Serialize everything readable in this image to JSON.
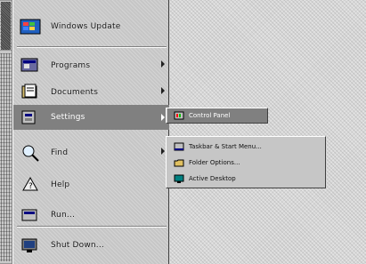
{
  "menu": {
    "header_label": "Windows Update",
    "items": [
      {
        "label": "Programs",
        "icon": "programs-icon",
        "has_submenu": true
      },
      {
        "label": "Documents",
        "icon": "documents-icon",
        "has_submenu": true
      },
      {
        "label": "Settings",
        "icon": "settings-icon",
        "has_submenu": true,
        "active": true
      },
      {
        "label": "Find",
        "icon": "find-icon",
        "has_submenu": true
      },
      {
        "label": "Help",
        "icon": "help-icon",
        "has_submenu": false
      },
      {
        "label": "Run...",
        "icon": "run-icon",
        "has_submenu": false
      },
      {
        "label": "Shut Down...",
        "icon": "shutdown-icon",
        "has_submenu": false
      }
    ]
  },
  "submenu_settings": {
    "items": [
      {
        "label": "Control Panel",
        "icon": "control-panel-icon",
        "active": true
      }
    ]
  },
  "submenu_settings_extra": {
    "items": [
      {
        "label": "Taskbar & Start Menu...",
        "icon": "taskbar-icon"
      },
      {
        "label": "Folder Options...",
        "icon": "folder-options-icon"
      },
      {
        "label": "Active Desktop",
        "icon": "active-desktop-icon"
      }
    ]
  },
  "colors": {
    "menu_bg": "#c6c6c6",
    "highlight": "#808080",
    "highlight_text": "#ffffff"
  }
}
